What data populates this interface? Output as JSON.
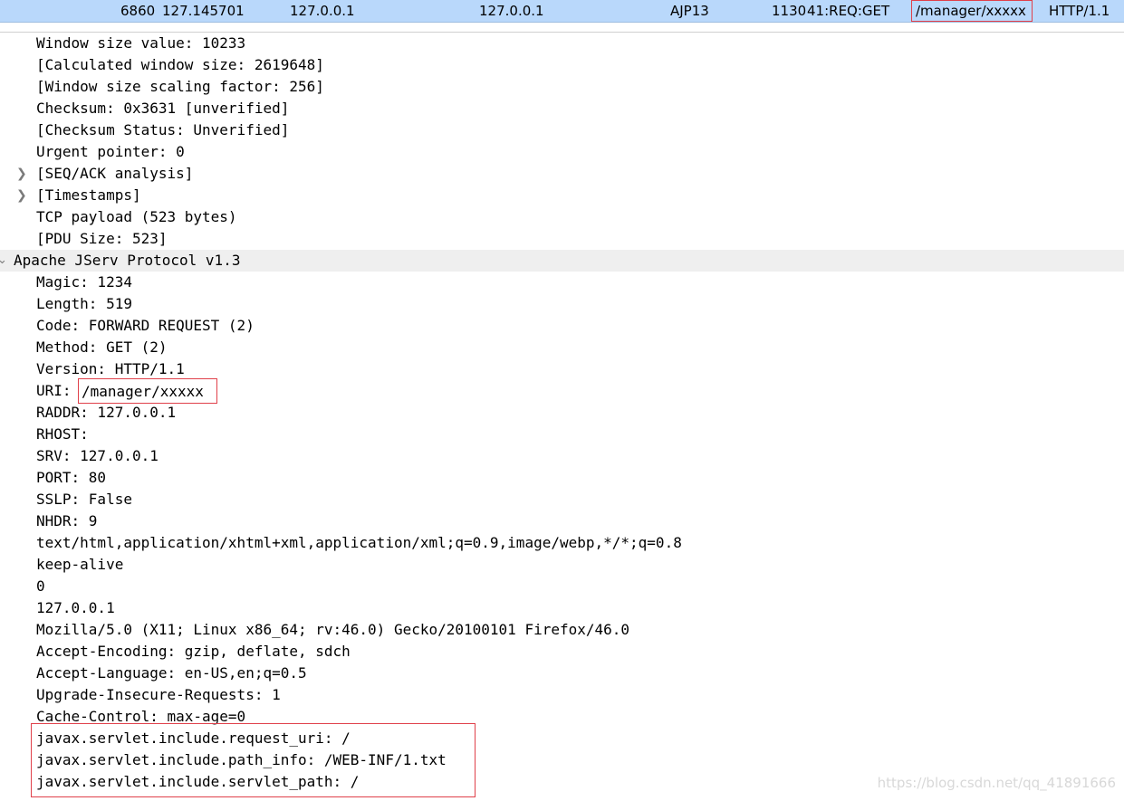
{
  "packet": {
    "no": "6860",
    "time": "127.145701",
    "source": "127.0.0.1",
    "destination": "127.0.0.1",
    "protocol": "AJP13",
    "length": "1130",
    "info_prefix": "41:REQ:GET",
    "info_uri": "/manager/xxxxx",
    "info_suffix": "HTTP/1.1"
  },
  "tcp_fields": [
    "Window size value: 10233",
    "[Calculated window size: 2619648]",
    "[Window size scaling factor: 256]",
    "Checksum: 0x3631 [unverified]",
    "[Checksum Status: Unverified]",
    "Urgent pointer: 0",
    "[SEQ/ACK analysis]",
    "[Timestamps]",
    "TCP payload (523 bytes)",
    "[PDU Size: 523]"
  ],
  "ajp": {
    "title": "Apache JServ Protocol v1.3",
    "fields_before_uri": [
      "Magic: 1234",
      "Length: 519",
      "Code: FORWARD REQUEST (2)",
      "Method: GET (2)",
      "Version: HTTP/1.1"
    ],
    "uri_label": "URI:",
    "uri_value": "/manager/xxxxx",
    "fields_after_uri": [
      "RADDR: 127.0.0.1",
      "RHOST:",
      "SRV: 127.0.0.1",
      "PORT: 80",
      "SSLP: False",
      "NHDR: 9",
      "text/html,application/xhtml+xml,application/xml;q=0.9,image/webp,*/*;q=0.8",
      "keep-alive",
      "0",
      "127.0.0.1",
      "Mozilla/5.0 (X11; Linux x86_64; rv:46.0) Gecko/20100101 Firefox/46.0",
      "Accept-Encoding: gzip, deflate, sdch",
      "Accept-Language: en-US,en;q=0.5",
      "Upgrade-Insecure-Requests: 1",
      "Cache-Control: max-age=0"
    ],
    "attributes": [
      "javax.servlet.include.request_uri: /",
      "javax.servlet.include.path_info: /WEB-INF/1.txt",
      "javax.servlet.include.servlet_path: /"
    ]
  },
  "watermark": "https://blog.csdn.net/qq_41891666",
  "colors": {
    "selected_row": "#b9d8fb",
    "highlight_box": "#e0404a",
    "tree_header_bg": "#efefef"
  }
}
